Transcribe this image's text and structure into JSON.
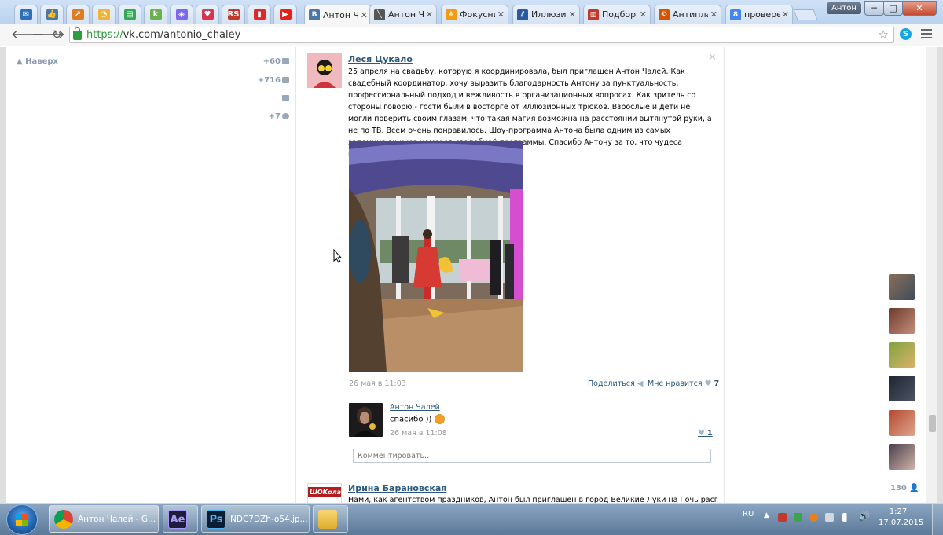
{
  "browser": {
    "pinned_tabs": [
      {
        "icon": "mail-icon",
        "color": "#2d6fba",
        "glyph": "✉"
      },
      {
        "icon": "thumbs-up-icon",
        "color": "#4a76a8",
        "glyph": "👍"
      },
      {
        "icon": "chart-icon",
        "color": "#e07b20",
        "glyph": "↗"
      },
      {
        "icon": "pie-icon",
        "color": "#f2b234",
        "glyph": "◔"
      },
      {
        "icon": "document-icon",
        "color": "#32a852",
        "glyph": "▤"
      },
      {
        "icon": "k-icon",
        "color": "#6ab04c",
        "glyph": "k"
      },
      {
        "icon": "shield-icon",
        "color": "#7b68ee",
        "glyph": "◈"
      },
      {
        "icon": "heart-icon",
        "color": "#d9344f",
        "glyph": "♥"
      },
      {
        "icon": "rs-icon",
        "color": "#c0392b",
        "glyph": "RS"
      },
      {
        "icon": "flipboard-icon",
        "color": "#e12828",
        "glyph": "▮"
      },
      {
        "icon": "youtube-icon",
        "color": "#e62117",
        "glyph": "▶"
      }
    ],
    "tabs": [
      {
        "title": "Антон Ча",
        "icon": "vk-icon",
        "color": "#4a76a8",
        "glyph": "В",
        "active": true
      },
      {
        "title": "Антон Ча",
        "icon": "pen-icon",
        "color": "#555555",
        "glyph": "╲",
        "active": false
      },
      {
        "title": "Фокусни",
        "icon": "joomla-icon",
        "color": "#f39c12",
        "glyph": "✻",
        "active": false
      },
      {
        "title": "Иллюзио",
        "icon": "wiki-icon",
        "color": "#2c5aa0",
        "glyph": "⫽",
        "active": false
      },
      {
        "title": "Подбор",
        "icon": "stats-icon",
        "color": "#c0392b",
        "glyph": "▥",
        "active": false
      },
      {
        "title": "Антипла",
        "icon": "copyright-icon",
        "color": "#d35400",
        "glyph": "©",
        "active": false
      },
      {
        "title": "провере",
        "icon": "google-icon",
        "color": "#4285f4",
        "glyph": "8",
        "active": false
      }
    ],
    "user_badge": "Антон",
    "window_buttons": {
      "minimize": "─",
      "maximize": "□",
      "close": "✕"
    },
    "url_protocol": "https://",
    "url_rest": "vk.com/antonio_chaley",
    "skype_glyph": "S"
  },
  "left_menu": {
    "to_top": "Наверх",
    "counters": [
      {
        "value": "+60",
        "icon": "messages-icon"
      },
      {
        "value": "+716",
        "icon": "friends-icon"
      },
      {
        "value": "",
        "icon": "comments-icon"
      },
      {
        "value": "+7",
        "icon": "settings-icon"
      }
    ]
  },
  "post1": {
    "author": "Леся Цукало",
    "close_glyph": "✕",
    "text": "25 апреля на свадьбу, которую я координировала, был приглашен Антон Чалей. Как свадебный координатор, хочу выразить благодарность Антону за пунктуальность, профессиональный подход и вежливость в организационных вопросах. Как зритель со стороны говорю - гости были в восторге от иллюзионных трюков. Взрослые и дети не могли поверить своим глазам, что такая магия возможна на расстоянии вытянутой руки, а не по ТВ. Всем очень понравилось. Шоу-программа Антона была одним из самых запоминающихся номеров свадебной программы. Спасибо Антону за то, что чудеса возможны",
    "date": "26 мая в 11:03",
    "share_label": "Поделиться",
    "like_label": "Мне нравится",
    "likes": "7",
    "comment": {
      "author": "Антон Чалей",
      "text": "спасибо ))",
      "date": "26 мая в 11:08",
      "likes": "1"
    },
    "comment_placeholder": "Комментировать.."
  },
  "post2": {
    "author": "Ирина Барановская",
    "avatar_text": "ШОКолад",
    "text": "Нами, как агентством праздников, Антон был приглашен в город Великие Луки на ночь распродаж, в"
  },
  "online_friends": {
    "count": "130",
    "avatars": [
      "friend-avatar-1",
      "friend-avatar-2",
      "friend-avatar-3",
      "friend-avatar-4",
      "friend-avatar-5",
      "friend-avatar-6"
    ]
  },
  "taskbar": {
    "buttons": [
      {
        "label": "Антон Чалей - G...",
        "icon": "chrome-icon"
      },
      {
        "label": "",
        "icon": "after-effects-icon",
        "glyph": "Ae"
      },
      {
        "label": "NDC7DZh-o54.jp...",
        "icon": "photoshop-icon",
        "glyph": "Ps"
      },
      {
        "label": "",
        "icon": "folder-icon"
      }
    ],
    "language": "RU",
    "time": "1:27",
    "date": "17.07.2015"
  }
}
